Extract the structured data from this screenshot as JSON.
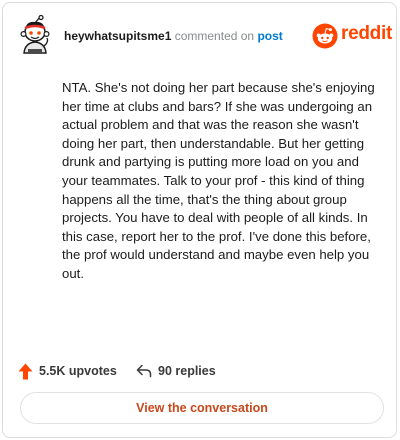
{
  "header": {
    "username": "heywhatsupitsme1",
    "action_text": "commented on",
    "post_link": "post",
    "brand": "reddit"
  },
  "comment": {
    "text": "NTA. She's not doing her part because she's enjoying her time at clubs and bars? If she was undergoing an actual problem and that was the reason she wasn't doing her part, then understandable. But her getting drunk and partying is putting more load on you and your teammates. Talk to your prof - this kind of thing happens all the time, that's the thing about group projects. You have to deal with people of all kinds. In this case, report her to the prof. I've done this before, the prof would understand and maybe even help you out."
  },
  "footer": {
    "upvotes": "5.5K upvotes",
    "replies": "90 replies"
  },
  "cta": {
    "label": "View the conversation"
  },
  "colors": {
    "brand": "#ff4500",
    "link": "#0079d3",
    "cta_text": "#c8481b"
  },
  "icons": {
    "avatar": "snoo-avatar-icon",
    "brand": "reddit-logo-icon",
    "upvote": "upvote-arrow-icon",
    "reply": "reply-arrow-icon"
  }
}
